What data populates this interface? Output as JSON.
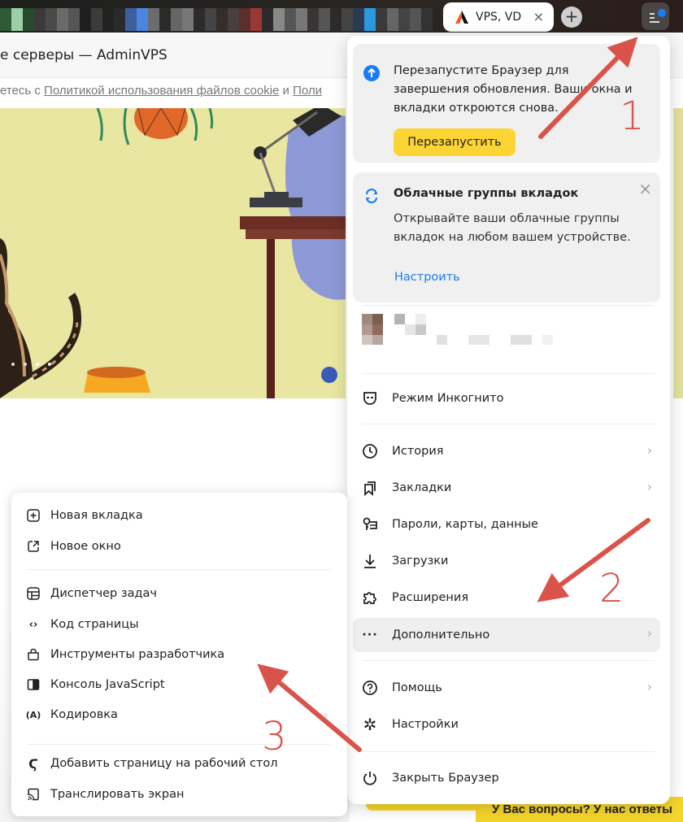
{
  "browser": {
    "active_tab": {
      "title": "VPS, VD",
      "close": "×"
    },
    "new_tab": "+",
    "menu_button_badge_color": "#1a7cf2"
  },
  "page": {
    "title": "е серверы — AdminVPS",
    "cookie": {
      "prefix": "етесь с ",
      "link1": "Политикой использования файлов cookie",
      "mid": " и ",
      "link2": "Поли"
    },
    "banner": "У Вас вопросы? У нас ответы"
  },
  "main_menu": {
    "update_card": {
      "text": "Перезапустите Браузер для завершения обновления. Ваши окна и вкладки откроются снова.",
      "button": "Перезапустить"
    },
    "cloud_card": {
      "title": "Облачные группы вкладок",
      "body": "Открывайте ваши облачные группы вкладок на любом вашем устройстве.",
      "link": "Настроить",
      "close": "×"
    },
    "items": [
      {
        "label": "Режим Инкогнито",
        "icon": "incognito-icon"
      },
      {
        "label": "История",
        "icon": "history-icon",
        "submenu": true
      },
      {
        "label": "Закладки",
        "icon": "bookmarks-icon",
        "submenu": true
      },
      {
        "label": "Пароли, карты, данные",
        "icon": "passwords-icon"
      },
      {
        "label": "Загрузки",
        "icon": "download-icon"
      },
      {
        "label": "Расширения",
        "icon": "extensions-icon"
      },
      {
        "label": "Дополнительно",
        "icon": "more-icon",
        "submenu": true,
        "highlighted": true
      },
      {
        "label": "Помощь",
        "icon": "help-icon",
        "submenu": true
      },
      {
        "label": "Настройки",
        "icon": "settings-icon"
      },
      {
        "label": "Закрыть Браузер",
        "icon": "power-icon"
      }
    ]
  },
  "sub_menu": {
    "items": [
      {
        "label": "Новая вкладка",
        "icon": "new-tab-icon"
      },
      {
        "label": "Новое окно",
        "icon": "new-window-icon"
      },
      {
        "label": "Диспетчер задач",
        "icon": "task-manager-icon"
      },
      {
        "label": "Код страницы",
        "icon": "code-icon"
      },
      {
        "label": "Инструменты разработчика",
        "icon": "devtools-icon"
      },
      {
        "label": "Консоль JavaScript",
        "icon": "console-icon"
      },
      {
        "label": "Кодировка",
        "icon": "encoding-icon",
        "submenu": true
      },
      {
        "label": "Добавить страницу на рабочий стол",
        "icon": "add-to-desktop-icon"
      },
      {
        "label": "Транслировать экран",
        "icon": "cast-icon"
      }
    ]
  },
  "annotations": {
    "step1": "1",
    "step2": "2",
    "step3": "3",
    "color": "#d9534a"
  }
}
